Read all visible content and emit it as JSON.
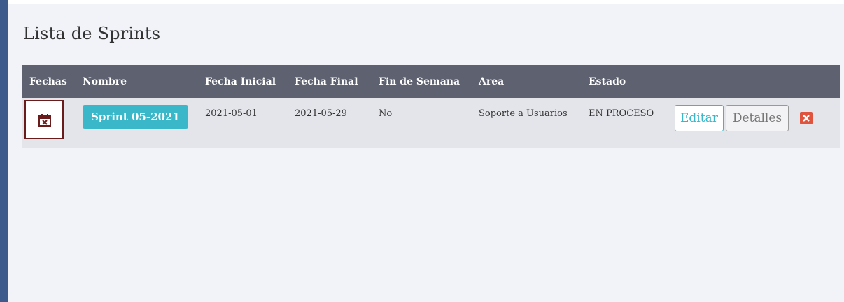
{
  "page": {
    "title": "Lista de Sprints"
  },
  "table": {
    "headers": {
      "fechas": "Fechas",
      "nombre": "Nombre",
      "fecha_inicial": "Fecha Inicial",
      "fecha_final": "Fecha Final",
      "fin_de_semana": "Fin de Semana",
      "area": "Area",
      "estado": "Estado"
    },
    "rows": [
      {
        "calendar_icon": "calendar-x-icon",
        "nombre": "Sprint 05-2021",
        "fecha_inicial": "2021-05-01",
        "fecha_final": "2021-05-29",
        "fin_de_semana": "No",
        "area": "Soporte a Usuarios",
        "estado": "EN PROCESO",
        "edit_label": "Editar",
        "details_label": "Detalles",
        "delete_icon": "delete-x-icon"
      }
    ]
  },
  "colors": {
    "sidebar": "#3c5a8c",
    "header_bg": "#5d6170",
    "row_bg": "#e4e5ea",
    "accent": "#3ab7c8",
    "delete": "#e0533d",
    "calendar_border": "#6a1c1c"
  }
}
